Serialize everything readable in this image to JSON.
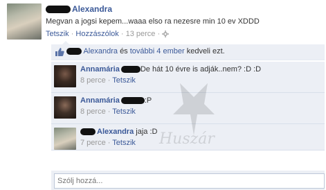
{
  "post": {
    "author": "Alexandra",
    "text": "Megvan a jogsi kepem...waaa elso ra nezesre min 10 ev XDDD",
    "actions": {
      "like": "Tetszik",
      "sep1": "·",
      "comments": "Hozzászólok",
      "sep2": "·",
      "time": "13 perce",
      "sep3": "·"
    },
    "icon": "gear-icon"
  },
  "likes": {
    "icon": "thumbs-up-icon",
    "name": "Alexandra",
    "and": "és",
    "others": "további 4 ember",
    "suffix": "kedveli ezt."
  },
  "comments": [
    {
      "author": "Annamária",
      "text": "De hát 10 évre is adják..nem? :D :D",
      "time": "8 perce",
      "sep": "·",
      "like": "Tetszik"
    },
    {
      "author": "Annamária",
      "text": ":P",
      "time": "8 perce",
      "sep": "·",
      "like": "Tetszik"
    },
    {
      "author": "Alexandra",
      "text": "jaja :D",
      "time": "7 perce",
      "sep": "·",
      "like": "Tetszik"
    }
  ],
  "composer": {
    "placeholder": "Szólj hozzá..."
  },
  "watermark": {
    "text": "Huszár"
  },
  "colors": {
    "link": "#3b5998",
    "ufi_bg": "#eceff5",
    "meta": "#999999"
  }
}
